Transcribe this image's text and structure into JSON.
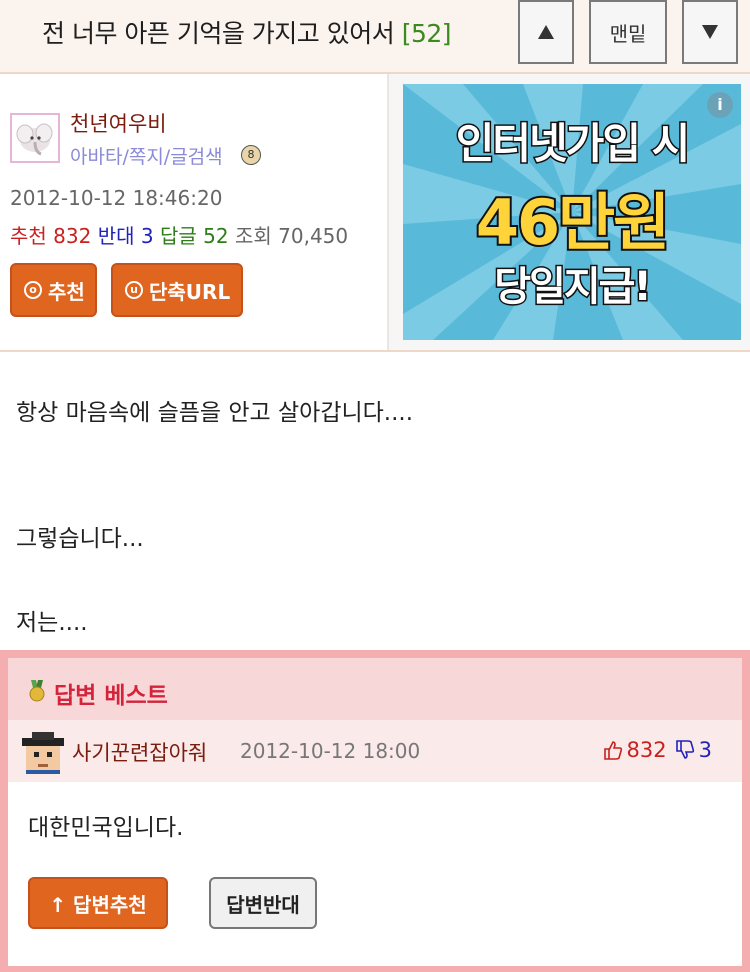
{
  "header": {
    "title": "전 너무 아픈 기억을 가지고 있어서",
    "reply_count": "[52]",
    "up_icon": "triangle-up-icon",
    "bottom_label": "맨밑",
    "down_icon": "triangle-down-icon"
  },
  "author": {
    "avatar_icon": "elephant-avatar",
    "name": "천년여우비",
    "links": "아바타/쪽지/글검색",
    "date": "2012-10-12 18:46:20",
    "stats": {
      "rec_label": "추천",
      "rec_value": "832",
      "opp_label": "반대",
      "opp_value": "3",
      "reply_label": "답글",
      "reply_value": "52",
      "view_label": "조회",
      "view_value": "70,450"
    },
    "buttons": {
      "recommend": "추천",
      "recommend_icon": "ⓞ",
      "short_url": "단축URL",
      "short_url_icon": "ⓤ"
    }
  },
  "ad": {
    "line1": "인터넷가입 시",
    "line2": "46만원",
    "line3": "당일지급!",
    "info_label": "i"
  },
  "content": {
    "lines": [
      "항상 마음속에 슬픔을 안고 살아갑니다....",
      "그렇습니다...",
      "저는...."
    ]
  },
  "best_answer": {
    "section_title": "답변 베스트",
    "author": "사기꾼련잡아줘",
    "date": "2012-10-12 18:00",
    "up_votes": "832",
    "down_votes": "3",
    "text": "대한민국입니다.",
    "recommend_button": "↑ 답변추천",
    "oppose_button": "답변반대"
  },
  "colors": {
    "title_bg": "#fbf3ee",
    "accent_orange": "#e0651f",
    "count_green": "#3b8a1e",
    "best_border": "#f4aeb0",
    "best_title": "#d4233a"
  }
}
